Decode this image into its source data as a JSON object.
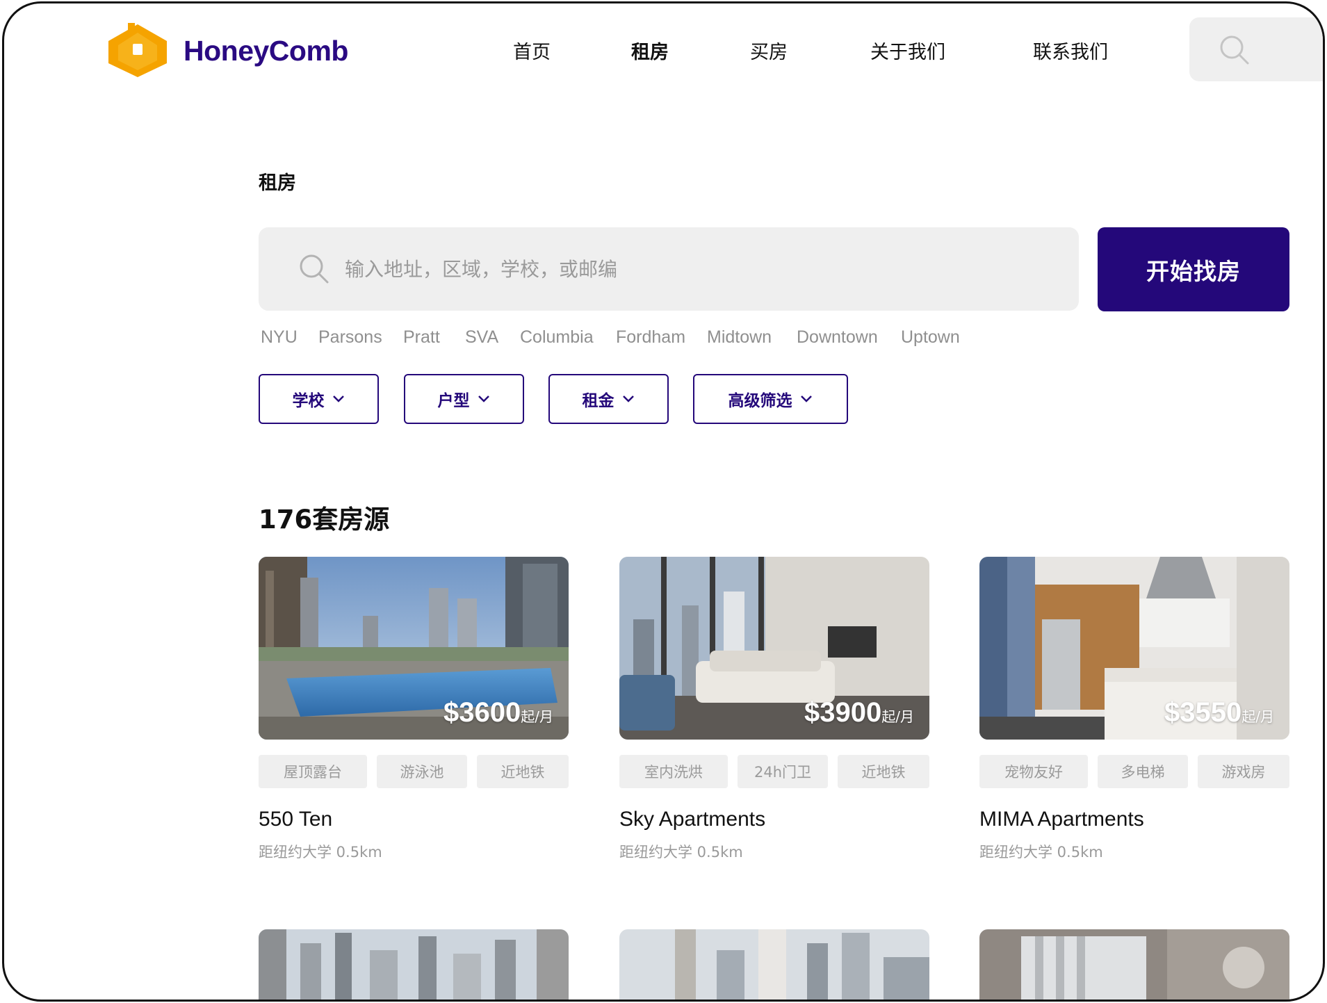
{
  "brand": {
    "name": "HoneyComb",
    "logo_icon": "honeycomb-house-logo",
    "logo_color": "#f5a300",
    "brand_color": "#2a0a82"
  },
  "nav": {
    "items": [
      {
        "label": "首页"
      },
      {
        "label": "租房",
        "active": true
      },
      {
        "label": "买房"
      },
      {
        "label": "关于我们"
      },
      {
        "label": "联系我们"
      }
    ],
    "search_icon": "search-icon"
  },
  "page": {
    "section_label": "租房",
    "search": {
      "placeholder": "输入地址，区域，学校，或邮编",
      "value": ""
    },
    "cta_label": "开始找房",
    "accent_color": "#24087a",
    "quick_tags": [
      "NYU",
      "Parsons",
      "Pratt",
      "SVA",
      "Columbia",
      "Fordham",
      "Midtown",
      "Downtown",
      "Uptown"
    ],
    "filters": [
      {
        "label": "学校"
      },
      {
        "label": "户型"
      },
      {
        "label": "租金"
      },
      {
        "label": "高级筛选"
      }
    ],
    "results_count": "176套房源"
  },
  "listings": [
    {
      "name": "550 Ten",
      "price": "$3600",
      "price_unit": "起/月",
      "tags": [
        "屋顶露台",
        "游泳池",
        "近地铁"
      ],
      "distance": "距纽约大学 0.5km"
    },
    {
      "name": "Sky Apartments",
      "price": "$3900",
      "price_unit": "起/月",
      "tags": [
        "室内洗烘",
        "24h门卫",
        "近地铁"
      ],
      "distance": "距纽约大学 0.5km"
    },
    {
      "name": "MIMA Apartments",
      "price": "$3550",
      "price_unit": "起/月",
      "tags": [
        "宠物友好",
        "多电梯",
        "游戏房"
      ],
      "distance": "距纽约大学 0.5km"
    }
  ]
}
